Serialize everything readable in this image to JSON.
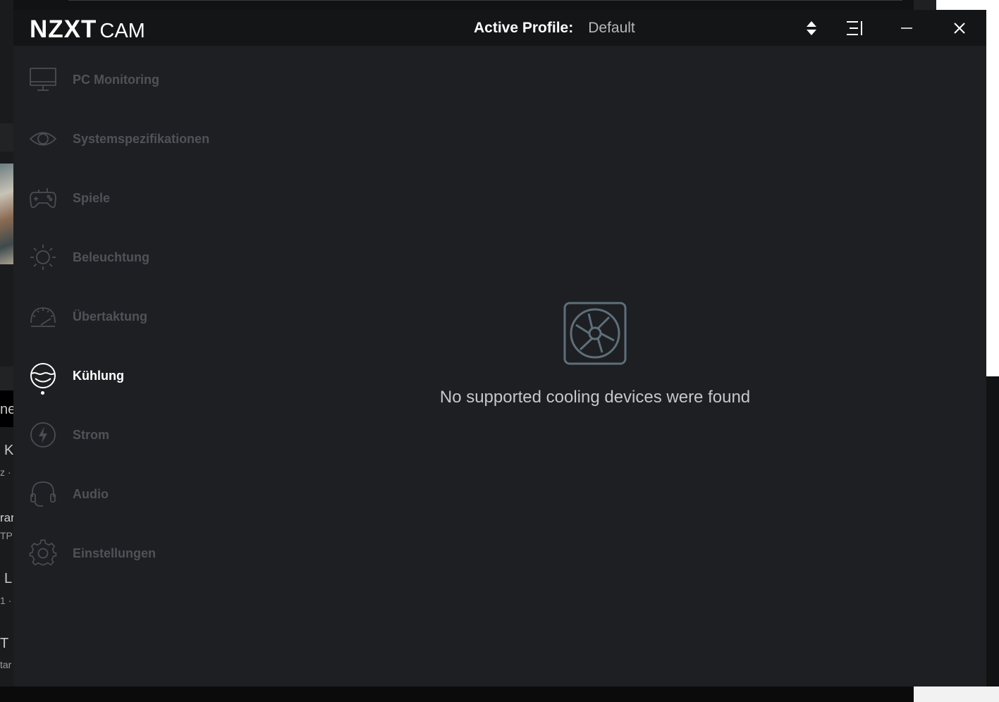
{
  "app": {
    "logo_main": "NZXT",
    "logo_sub": "CAM",
    "active_profile_label": "Active Profile:",
    "active_profile_value": "Default"
  },
  "titlebar_icons": [
    "sort-arrows-icon",
    "menu-lines-icon",
    "minimize-icon",
    "close-icon"
  ],
  "sidebar": {
    "items": [
      {
        "label": "PC Monitoring",
        "icon": "monitor-icon"
      },
      {
        "label": "Systemspezifikationen",
        "icon": "eye-icon"
      },
      {
        "label": "Spiele",
        "icon": "gamepad-icon"
      },
      {
        "label": "Beleuchtung",
        "icon": "sun-icon"
      },
      {
        "label": "Übertaktung",
        "icon": "gauge-icon"
      },
      {
        "label": "Kühlung",
        "icon": "cooling-icon",
        "active": true
      },
      {
        "label": "Strom",
        "icon": "power-bolt-icon"
      },
      {
        "label": "Audio",
        "icon": "headset-icon"
      },
      {
        "label": "Einstellungen",
        "icon": "gear-icon"
      }
    ]
  },
  "main": {
    "empty_icon": "fan-icon",
    "empty_message": "No supported cooling devices were found"
  },
  "background": {
    "fragments": [
      "ne",
      "K",
      "z ·",
      "rar",
      "TP",
      "L",
      "1 ·",
      "T",
      "tar"
    ]
  },
  "colors": {
    "window_bg": "#1d1f22",
    "titlebar_bg": "#141517",
    "nav_inactive": "#4f5257",
    "nav_active": "#ffffff",
    "message_text": "#c4c7cb"
  }
}
